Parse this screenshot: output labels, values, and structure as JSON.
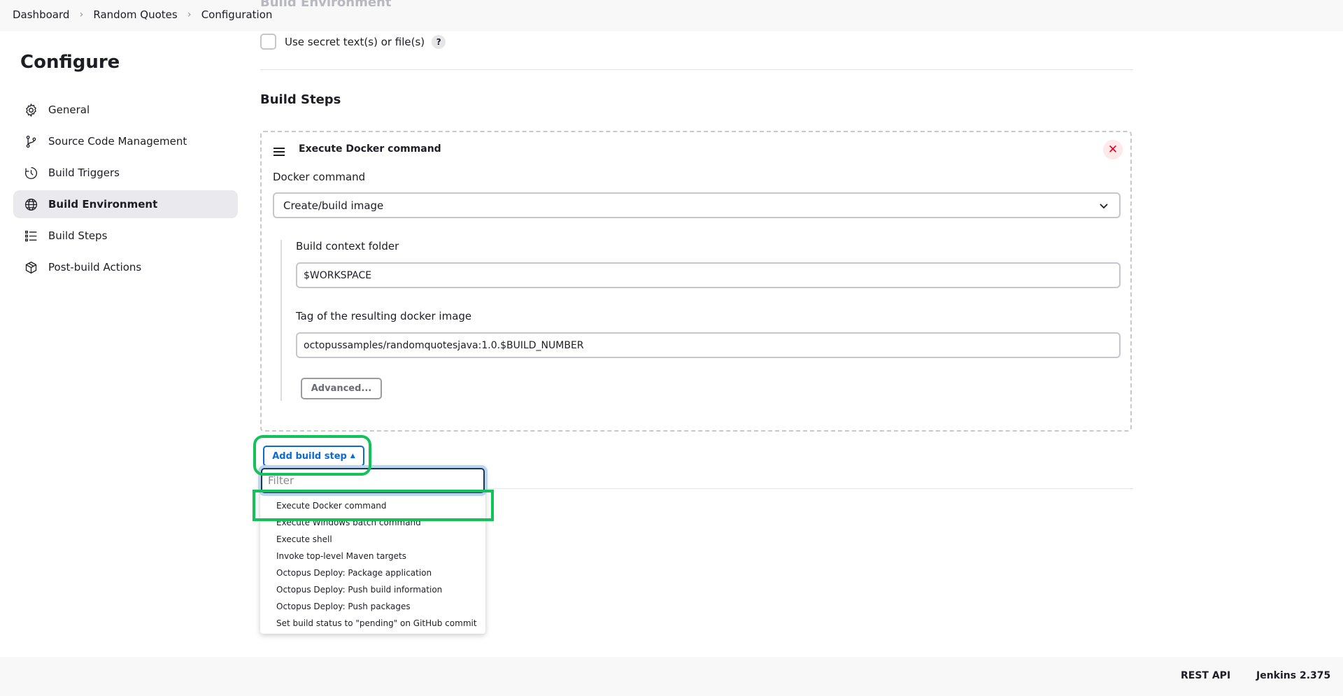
{
  "breadcrumb": {
    "items": [
      "Dashboard",
      "Random Quotes",
      "Configuration"
    ]
  },
  "sidebar": {
    "title": "Configure",
    "items": [
      {
        "label": "General",
        "icon": "gear-icon"
      },
      {
        "label": "Source Code Management",
        "icon": "branch-icon"
      },
      {
        "label": "Build Triggers",
        "icon": "clock-icon"
      },
      {
        "label": "Build Environment",
        "icon": "globe-icon",
        "active": true
      },
      {
        "label": "Build Steps",
        "icon": "list-icon"
      },
      {
        "label": "Post-build Actions",
        "icon": "package-icon"
      }
    ]
  },
  "build_environment": {
    "heading": "Build Environment",
    "secret_checkbox_label": "Use secret text(s) or file(s)",
    "help": "?"
  },
  "build_steps": {
    "title": "Build Steps",
    "step": {
      "title": "Execute Docker command",
      "close": "✕",
      "docker_command_label": "Docker command",
      "docker_command_value": "Create/build image",
      "context_folder_label": "Build context folder",
      "context_folder_value": "$WORKSPACE",
      "tag_label": "Tag of the resulting docker image",
      "tag_value": "octopussamples/randomquotesjava:1.0.$BUILD_NUMBER",
      "advanced_label": "Advanced..."
    },
    "add_button_label": "Add build step",
    "add_button_caret": "▲"
  },
  "dropdown": {
    "filter_placeholder": "Filter",
    "items": [
      "Execute Docker command",
      "Execute Windows batch command",
      "Execute shell",
      "Invoke top-level Maven targets",
      "Octopus Deploy: Package application",
      "Octopus Deploy: Push build information",
      "Octopus Deploy: Push packages",
      "Set build status to \"pending\" on GitHub commit"
    ]
  },
  "footer": {
    "rest_api": "REST API",
    "version": "Jenkins 2.375"
  },
  "colors": {
    "accent": "#0b6ad5",
    "highlight": "#14c25a",
    "danger": "#e6001f"
  }
}
